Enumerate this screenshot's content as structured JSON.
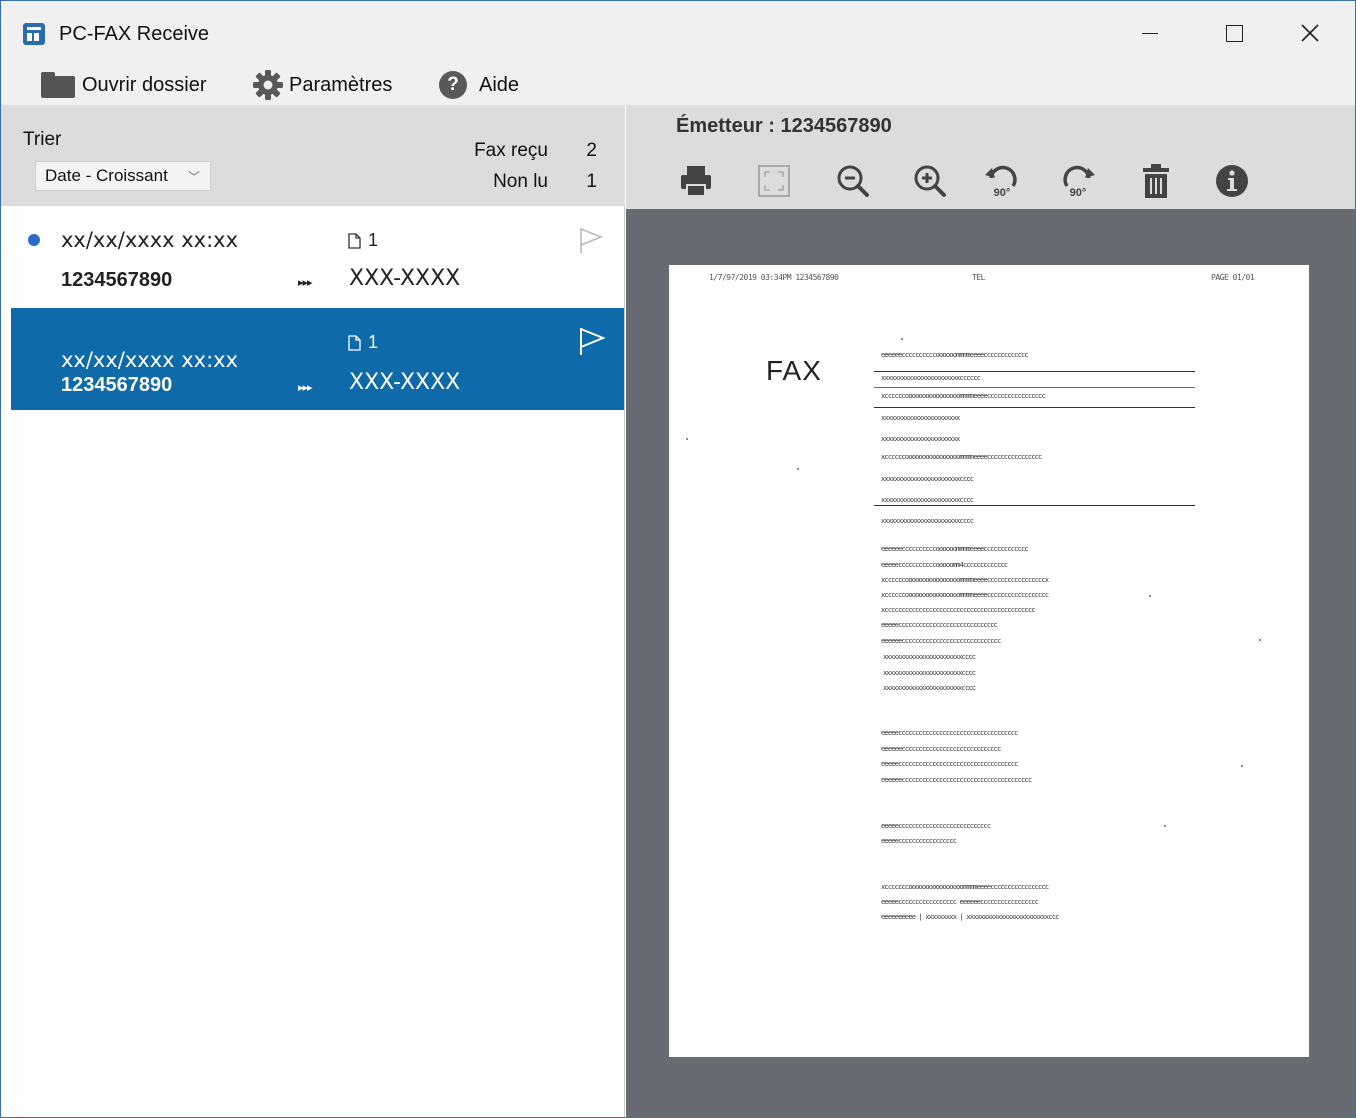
{
  "window": {
    "title": "PC-FAX Receive",
    "controls": {
      "minimize": "—",
      "maximize": "☐",
      "close": "✕"
    }
  },
  "toolbar": {
    "open_folder": "Ouvrir dossier",
    "settings": "Paramètres",
    "help": "Aide",
    "help_icon": "?"
  },
  "sort": {
    "label": "Trier",
    "selected": "Date - Croissant"
  },
  "stats": {
    "received_label": "Fax reçu",
    "received_count": "2",
    "unread_label": "Non lu",
    "unread_count": "1"
  },
  "fax_list": [
    {
      "date": "xx/xx/xxxx xx:xx",
      "pages": "1",
      "sender": "1234567890",
      "arrows": "▸▸▸",
      "destination": "XXX-XXXX",
      "unread": true,
      "selected": false
    },
    {
      "date": "xx/xx/xxxx xx:xx",
      "pages": "1",
      "sender": "1234567890",
      "arrows": "▸▸▸",
      "destination": "XXX-XXXX",
      "unread": false,
      "selected": true
    }
  ],
  "preview": {
    "sender_label": "Émetteur : 1234567890",
    "tools": [
      "print-icon",
      "fit-icon",
      "zoom-out-icon",
      "zoom-in-icon",
      "rotate-left-icon",
      "rotate-right-icon",
      "delete-icon",
      "info-icon"
    ],
    "rotate_label": "90°",
    "accent_color": "#0e6aa8",
    "viewer_bg": "#686c72"
  },
  "fax_page": {
    "header_left": "1/7/97/2019  03:34PM  1234567890",
    "header_mid": "TEL",
    "header_right": "PAGE  01/01",
    "heading": "FAX",
    "lines": [
      "eeeeeeccccccccccoooooommmmeeeeccccccccccccc",
      "xxxxxxxxxxxxxxxxxxxxxxxcccccc",
      "xccccccoooooooooooooooommmmeeeeccccccccccccccccc",
      "xxxxxxxxxxxxxxxxxxxxxxx",
      "xxxxxxxxxxxxxxxxxxxxxxx",
      "xccccccoooooooooooooooommmmeeeecccccccccccccccc",
      "xxxxxxxxxxxxxxxxxxxxxxxcccc",
      "xxxxxxxxxxxxxxxxxxxxxxxcccc",
      "xxxxxxxxxxxxxxxxxxxxxxxcccc",
      "eeeeeeccccccccccoooooommmmeeeeccccccccccccc",
      "eeeeecccccccccccooooomm4ccccccccccccc",
      "xccccccoooooooooooooooommmmeeeecccccccccccccccccx",
      "xccccccoooooooooooooooommmmeeeecccccccccccccccccc",
      "xcccccccccccccccccccccccccccccccccccccccccccc",
      "eeeeeccccccccccccccccccccccccccccc",
      "eeeeeeccccccccccccccccccccccccccccc",
      "xxxxxxxxxxxxxxxxxxxxxxxcccc",
      "xxxxxxxxxxxxxxxxxxxxxxxcccc",
      "xxxxxxxxxxxxxxxxxxxxxxxcccc",
      "eeeeeccccccccccccccccccccccccccccccccccc",
      "eeeeeeccccccccccccccccccccccccccccc",
      "eeeeeccccccccccccccccccccccccccccccccccc",
      "eeeeeecccccccccccccccccccccccccccccccccccccc",
      "eeeeeccccccccccccccccccccccccccc",
      "eeeeeccccccccccccccccc",
      "xcccccccoooooooooooooooommmmeeeeccccccccccccccccc",
      "eeeeeccccccccccccccccc   eeeeeeccccccccccccccccc",
      "eeeeeeeeee  |  xxxxxxxxx  |  xxxxxxxxxxxxxxxxxxxxxxxxccc"
    ]
  }
}
